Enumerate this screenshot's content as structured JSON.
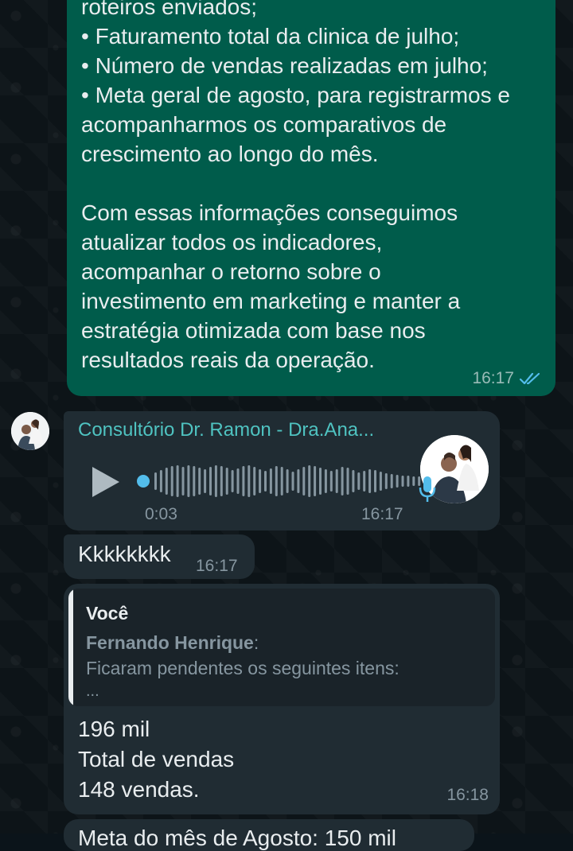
{
  "outgoing": {
    "text": "roteiros enviados;\n• Faturamento total da clinica de julho;\n• Número de vendas realizadas em julho;\n• Meta geral de agosto, para registrarmos e\nacompanharmos os comparativos de\ncrescimento ao longo do mês.\n\nCom essas informações conseguimos\natualizar todos os indicadores,\nacompanhar o retorno sobre o\ninvestimento em marketing e manter a\nestratégia otimizada com base nos\nresultados reais da operação.",
    "time": "16:17",
    "status_icon": "double-check-icon"
  },
  "voice_message": {
    "sender": "Consultório Dr. Ramon - Dra.Ana...",
    "duration": "0:03",
    "time": "16:17",
    "progress": 0
  },
  "short_message": {
    "text": "Kkkkkkkk",
    "time": "16:17"
  },
  "reply_message": {
    "quoted_author": "Você",
    "quoted_name": "Fernando Henrique",
    "quoted_name_suffix": ":",
    "quoted_text": "Ficaram pendentes os seguintes itens:",
    "quoted_more": "...",
    "line1": "196 mil",
    "line2": "Total de vendas",
    "line3": "148 vendas.",
    "time": "16:18"
  },
  "next_message": {
    "text": "Meta do mês de Agosto: 150 mil"
  },
  "colors": {
    "outgoing_bubble": "#005c4b",
    "incoming_bubble": "#202c33",
    "sender_name": "#4fc3c1",
    "read_ticks": "#53bdeb"
  }
}
